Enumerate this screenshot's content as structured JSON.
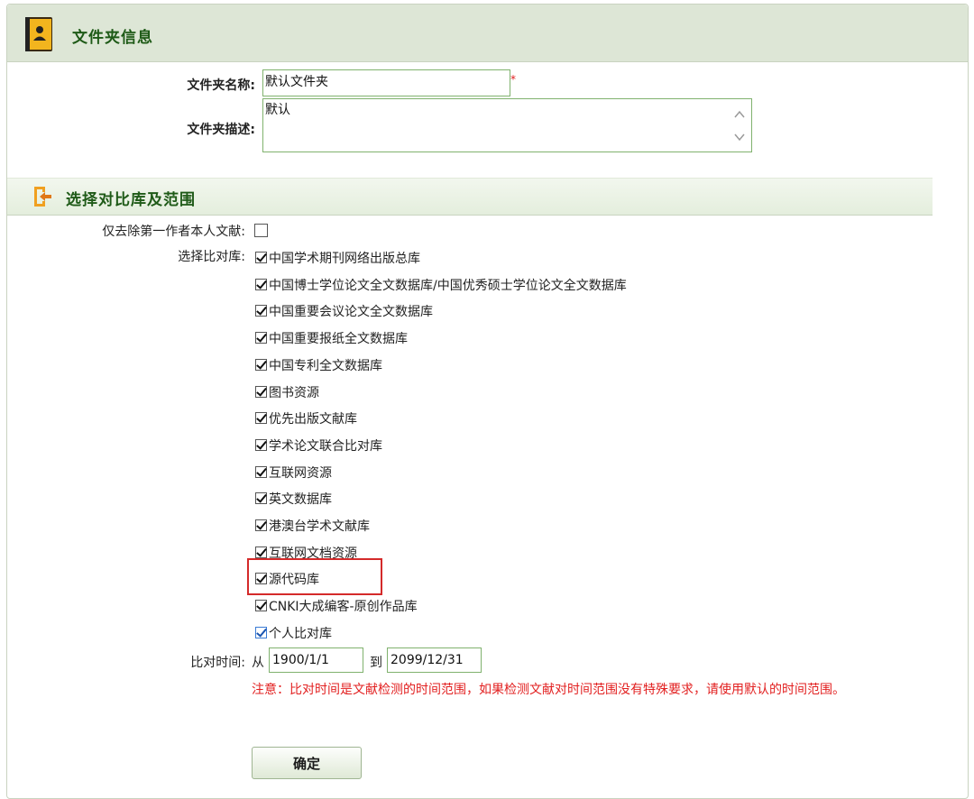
{
  "header": {
    "title": "文件夹信息",
    "icon": "contact-book-icon"
  },
  "form": {
    "folder_name_label": "文件夹名称:",
    "folder_name_value": "默认文件夹",
    "required_mark": "*",
    "folder_desc_label": "文件夹描述:",
    "folder_desc_value": "默认"
  },
  "section": {
    "title": "选择对比库及范围",
    "icon": "exit-arrow-icon"
  },
  "options": {
    "exclude_first_author_label": "仅去除第一作者本人文献:",
    "exclude_first_author_checked": false,
    "select_db_label": "选择比对库:",
    "databases": [
      {
        "label": "中国学术期刊网络出版总库",
        "checked": true
      },
      {
        "label": "中国博士学位论文全文数据库/中国优秀硕士学位论文全文数据库",
        "checked": true
      },
      {
        "label": "中国重要会议论文全文数据库",
        "checked": true
      },
      {
        "label": "中国重要报纸全文数据库",
        "checked": true
      },
      {
        "label": "中国专利全文数据库",
        "checked": true
      },
      {
        "label": "图书资源",
        "checked": true
      },
      {
        "label": "优先出版文献库",
        "checked": true
      },
      {
        "label": "学术论文联合比对库",
        "checked": true
      },
      {
        "label": "互联网资源",
        "checked": true
      },
      {
        "label": "英文数据库",
        "checked": true
      },
      {
        "label": "港澳台学术文献库",
        "checked": true
      },
      {
        "label": "互联网文档资源",
        "checked": true
      },
      {
        "label": "源代码库",
        "checked": true
      },
      {
        "label": "CNKI大成编客-原创作品库",
        "checked": true
      },
      {
        "label": "个人比对库",
        "checked": true
      }
    ]
  },
  "time_range": {
    "label": "比对时间:",
    "from_label": "从",
    "from_value": "1900/1/1",
    "to_label": "到",
    "to_value": "2099/12/31",
    "note": "注意：比对时间是文献检测的时间范围，如果检测文献对时间范围没有特殊要求，请使用默认的时间范围。"
  },
  "submit_label": "确定",
  "colors": {
    "accent_green": "#1e5a17",
    "note_red": "#e22020",
    "highlight_red": "#d42a2a"
  }
}
